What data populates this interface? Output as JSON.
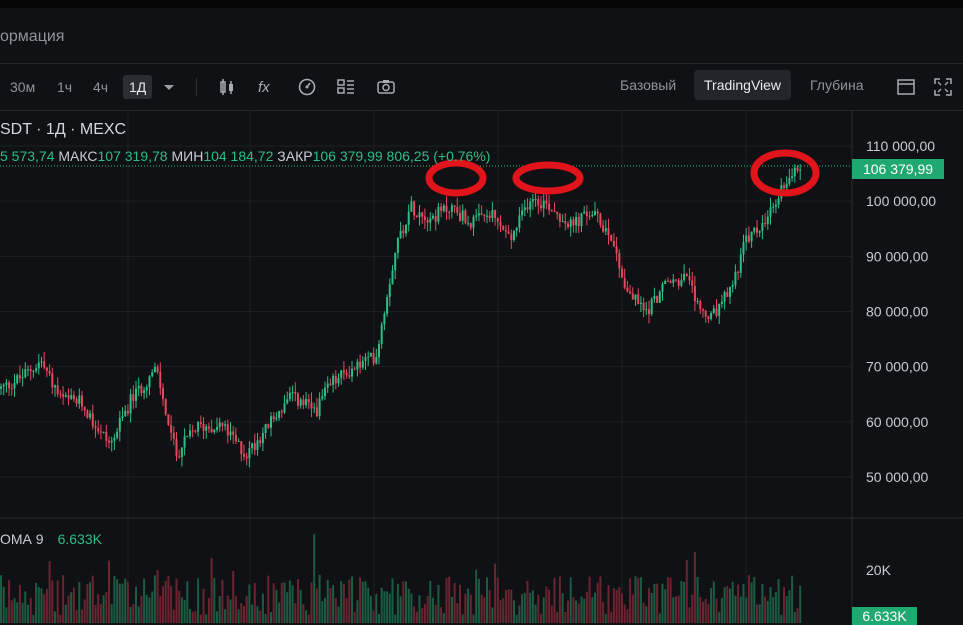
{
  "header": {
    "title": "ормация"
  },
  "toolbar": {
    "intervals": [
      "30м",
      "1ч",
      "4ч",
      "1Д"
    ],
    "active_interval": "1Д",
    "icons": [
      "candles-icon",
      "indicators-fx-icon",
      "gauge-icon",
      "layout-grid-icon",
      "camera-icon"
    ],
    "views": [
      "Базовый",
      "TradingView",
      "Глубина"
    ],
    "active_view": "TradingView",
    "right_icons": [
      "window-icon",
      "fullscreen-icon"
    ]
  },
  "legend": {
    "symbol": "SDT · 1Д · MEXC",
    "open_value": "5 573,74",
    "high_label": "МАКС",
    "high_value": "107 319,78",
    "low_label": "МИН",
    "low_value": "104 184,72",
    "close_label": "ЗАКР",
    "close_value": "106 379,99",
    "change": "806,25 (+0.76%)"
  },
  "price_axis": {
    "labels": [
      "110 000,00",
      "100 000,00",
      "90 000,00",
      "80 000,00",
      "70 000,00",
      "60 000,00",
      "50 000,00"
    ],
    "current_price": "106 379,99"
  },
  "volume": {
    "label": "ОМА 9",
    "value": "6.633K",
    "axis_label": "20K",
    "current_tag": "6.633K"
  },
  "chart_data": {
    "type": "candlestick",
    "y_axis": {
      "min": 47000,
      "max": 114000,
      "ticks": [
        50000,
        60000,
        70000,
        80000,
        90000,
        100000,
        110000
      ]
    },
    "current_close": 106379.99,
    "anchors": [
      [
        0,
        66000
      ],
      [
        20,
        68000
      ],
      [
        40,
        71000
      ],
      [
        60,
        64000
      ],
      [
        80,
        63500
      ],
      [
        100,
        58000
      ],
      [
        110,
        56000
      ],
      [
        130,
        64000
      ],
      [
        155,
        69500
      ],
      [
        175,
        54000
      ],
      [
        195,
        59000
      ],
      [
        220,
        59500
      ],
      [
        245,
        54000
      ],
      [
        270,
        60000
      ],
      [
        290,
        64500
      ],
      [
        315,
        62000
      ],
      [
        330,
        67000
      ],
      [
        355,
        70000
      ],
      [
        375,
        72000
      ],
      [
        395,
        92000
      ],
      [
        410,
        99000
      ],
      [
        430,
        97000
      ],
      [
        450,
        99000
      ],
      [
        470,
        96000
      ],
      [
        490,
        97500
      ],
      [
        510,
        93000
      ],
      [
        530,
        101000
      ],
      [
        550,
        99000
      ],
      [
        570,
        95500
      ],
      [
        590,
        98000
      ],
      [
        610,
        94000
      ],
      [
        625,
        84000
      ],
      [
        645,
        80000
      ],
      [
        665,
        85000
      ],
      [
        685,
        86000
      ],
      [
        700,
        80000
      ],
      [
        710,
        78500
      ],
      [
        730,
        84000
      ],
      [
        745,
        93000
      ],
      [
        765,
        96000
      ],
      [
        785,
        104000
      ],
      [
        800,
        106380
      ]
    ]
  }
}
